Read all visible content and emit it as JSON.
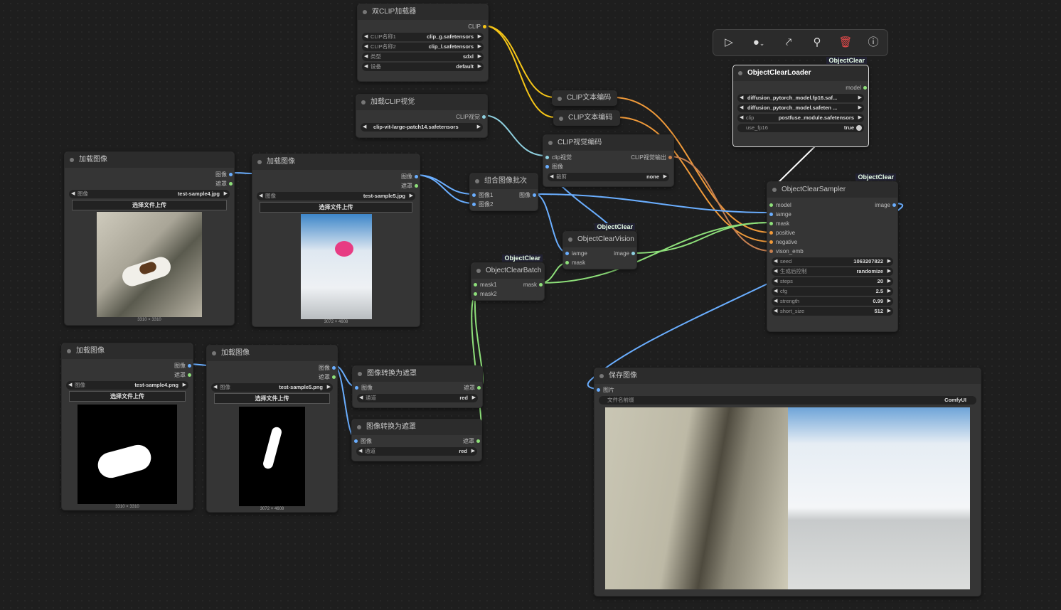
{
  "nodes": {
    "dual_clip": {
      "title": "双CLIP加载器",
      "out": "CLIP",
      "w1_label": "CLIP名称1",
      "w1_val": "clip_g.safetensors",
      "w2_label": "CLIP名称2",
      "w2_val": "clip_l.safetensors",
      "w3_label": "类型",
      "w3_val": "sdxl",
      "w4_label": "设备",
      "w4_val": "default"
    },
    "clip_vision_load": {
      "title": "加载CLIP视觉",
      "out": "CLIP视觉",
      "w_val": "clip-vit-large-patch14.safetensors"
    },
    "clip_text1": {
      "title": "CLIP文本编码"
    },
    "clip_text2": {
      "title": "CLIP文本编码"
    },
    "clip_vision_enc": {
      "title": "CLIP视觉编码",
      "in1": "clip视觉",
      "in2": "图像",
      "out": "CLIP视觉输出",
      "w_label": "裁剪",
      "w_val": "none"
    },
    "load1": {
      "title": "加载图像",
      "out1": "图像",
      "out2": "遮罩",
      "w_label": "图像",
      "w_val": "test-sample4.jpg",
      "btn": "选择文件上传",
      "cap": "3310 × 3310"
    },
    "load2": {
      "title": "加载图像",
      "out1": "图像",
      "out2": "遮罩",
      "w_label": "图像",
      "w_val": "test-sample5.jpg",
      "btn": "选择文件上传",
      "cap": "3072 × 4608"
    },
    "load3": {
      "title": "加载图像",
      "out1": "图像",
      "out2": "遮罩",
      "w_label": "图像",
      "w_val": "test-sample4.png",
      "btn": "选择文件上传",
      "cap": "3310 × 3310"
    },
    "load4": {
      "title": "加载图像",
      "out1": "图像",
      "out2": "遮罩",
      "w_label": "图像",
      "w_val": "test-sample5.png",
      "btn": "选择文件上传",
      "cap": "3072 × 4608"
    },
    "batch_img": {
      "title": "组合图像批次",
      "in1": "图像1",
      "in2": "图像2",
      "out": "图像"
    },
    "oc_vision": {
      "badge": "ObjectClear",
      "title": "ObjectClearVision",
      "in1": "iamge",
      "in2": "mask",
      "out": "image"
    },
    "oc_batch": {
      "badge": "ObjectClear",
      "title": "ObjectClearBatch",
      "in1": "mask1",
      "in2": "mask2",
      "out": "mask"
    },
    "img2mask1": {
      "title": "图像转换为遮罩",
      "in": "图像",
      "out": "遮罩",
      "w_label": "通道",
      "w_val": "red"
    },
    "img2mask2": {
      "title": "图像转换为遮罩",
      "in": "图像",
      "out": "遮罩",
      "w_label": "通道",
      "w_val": "red"
    },
    "oc_loader": {
      "badge": "ObjectClear",
      "title": "ObjectClearLoader",
      "out": "model",
      "w1": "diffusion_pytorch_model.fp16.saf...",
      "w2": "diffusion_pytorch_model.safeten ...",
      "w3_label": "clip",
      "w3_val": "postfuse_module.safetensors",
      "t_label": "use_fp16",
      "t_val": "true"
    },
    "oc_sampler": {
      "badge": "ObjectClear",
      "title": "ObjectClearSampler",
      "in1": "model",
      "in2": "iamge",
      "in3": "mask",
      "in4": "positive",
      "in5": "negative",
      "in6": "vison_emb",
      "out": "image",
      "widgets": [
        [
          "seed",
          "1063207822"
        ],
        [
          "生成后控制",
          "randomize"
        ],
        [
          "steps",
          "20"
        ],
        [
          "cfg",
          "2.5"
        ],
        [
          "strength",
          "0.99"
        ],
        [
          "short_size",
          "512"
        ]
      ]
    },
    "save": {
      "title": "保存图像",
      "in": "图片",
      "w_label": "文件名前缀",
      "w_val": "ComfyUI"
    }
  },
  "toolbar": {
    "icons": [
      "run-icon",
      "color-icon",
      "bypass-icon",
      "pin-icon",
      "delete-icon",
      "help-icon"
    ]
  },
  "colors": {
    "clip": "#f5c518",
    "image": "#6aaeff",
    "mask": "#8ee07a",
    "conditioning": "#f09a3a",
    "clip_vision": "#8fd0e0"
  }
}
